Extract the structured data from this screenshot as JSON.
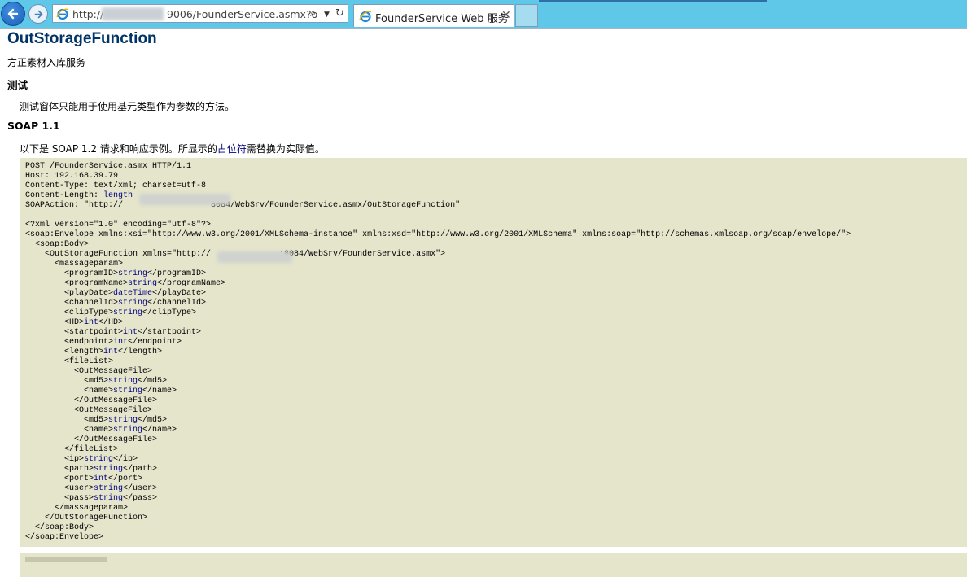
{
  "browser": {
    "address_prefix": "http://",
    "address_suffix": "9006/FounderService.asmx?o",
    "tab_title": "FounderService Web 服务",
    "tab_close": "✕",
    "search_glyph": "⌕",
    "dropdown_glyph": "▼",
    "refresh_glyph": "↻"
  },
  "page": {
    "title": "OutStorageFunction",
    "description": "方正素材入库服务",
    "test_heading": "测试",
    "test_note": "测试窗体只能用于使用基元类型作为参数的方法。",
    "soap_heading": "SOAP 1.1",
    "soap_intro_before": "以下是 SOAP 1.2 请求和响应示例。所显示的",
    "soap_intro_placeholder": "占位符",
    "soap_intro_after": "需替换为实际值。"
  },
  "code": {
    "l01": "POST /FounderService.asmx HTTP/1.1",
    "l02": "Host: 192.168.39.79",
    "l03": "Content-Type: text/xml; charset=utf-8",
    "l04a": "Content-Length: ",
    "l04b": "length",
    "l05a": "SOAPAction: \"http://",
    "l05b": "8084/WebSrv/FounderService.asmx/OutStorageFunction\"",
    "l07": "<?xml version=\"1.0\" encoding=\"utf-8\"?>",
    "l08": "<soap:Envelope xmlns:xsi=\"http://www.w3.org/2001/XMLSchema-instance\" xmlns:xsd=\"http://www.w3.org/2001/XMLSchema\" xmlns:soap=\"http://schemas.xmlsoap.org/soap/envelope/\">",
    "l09": "  <soap:Body>",
    "l10a": "    <OutStorageFunction xmlns=\"http://",
    "l10b": ":8084/WebSrv/FounderService.asmx\">",
    "l11": "      <massageparam>",
    "fields": [
      {
        "open": "        <programID>",
        "val": "string",
        "close": "</programID>"
      },
      {
        "open": "        <programName>",
        "val": "string",
        "close": "</programName>"
      },
      {
        "open": "        <playDate>",
        "val": "dateTime",
        "close": "</playDate>"
      },
      {
        "open": "        <channelId>",
        "val": "string",
        "close": "</channelId>"
      },
      {
        "open": "        <clipType>",
        "val": "string",
        "close": "</clipType>"
      },
      {
        "open": "        <HD>",
        "val": "int",
        "close": "</HD>"
      },
      {
        "open": "        <startpoint>",
        "val": "int",
        "close": "</startpoint>"
      },
      {
        "open": "        <endpoint>",
        "val": "int",
        "close": "</endpoint>"
      },
      {
        "open": "        <length>",
        "val": "int",
        "close": "</length>"
      }
    ],
    "l21": "        <fileList>",
    "l22": "          <OutMessageFile>",
    "f1md5": {
      "open": "            <md5>",
      "val": "string",
      "close": "</md5>"
    },
    "f1name": {
      "open": "            <name>",
      "val": "string",
      "close": "</name>"
    },
    "l25": "          </OutMessageFile>",
    "l26": "          <OutMessageFile>",
    "f2md5": {
      "open": "            <md5>",
      "val": "string",
      "close": "</md5>"
    },
    "f2name": {
      "open": "            <name>",
      "val": "string",
      "close": "</name>"
    },
    "l29": "          </OutMessageFile>",
    "l30": "        </fileList>",
    "tail": [
      {
        "open": "        <ip>",
        "val": "string",
        "close": "</ip>"
      },
      {
        "open": "        <path>",
        "val": "string",
        "close": "</path>"
      },
      {
        "open": "        <port>",
        "val": "int",
        "close": "</port>"
      },
      {
        "open": "        <user>",
        "val": "string",
        "close": "</user>"
      },
      {
        "open": "        <pass>",
        "val": "string",
        "close": "</pass>"
      }
    ],
    "l36": "      </massageparam>",
    "l37": "    </OutStorageFunction>",
    "l38": "  </soap:Body>",
    "l39": "</soap:Envelope>"
  },
  "colors": {
    "chrome": "#5fc8e8",
    "title": "#003366",
    "code_background": "#e5e5cc",
    "placeholder": "#000080"
  }
}
